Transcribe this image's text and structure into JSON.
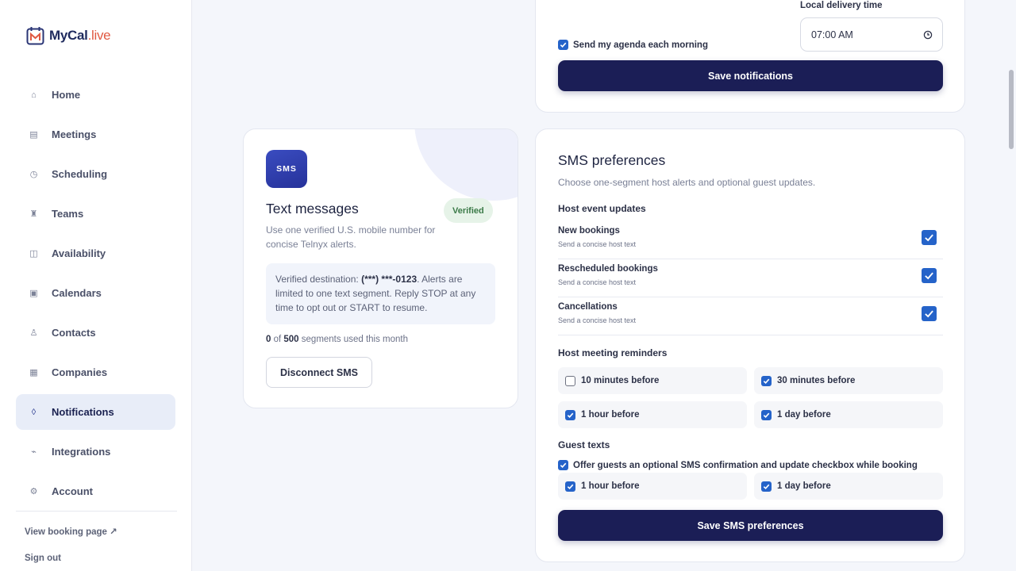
{
  "brand": {
    "name_main": "MyCal",
    "name_accent": ".live"
  },
  "sidebar": {
    "items": [
      {
        "label": "Home",
        "icon": "⌂",
        "name": "home"
      },
      {
        "label": "Meetings",
        "icon": "▤",
        "name": "meetings"
      },
      {
        "label": "Scheduling",
        "icon": "◷",
        "name": "scheduling"
      },
      {
        "label": "Teams",
        "icon": "♜",
        "name": "teams"
      },
      {
        "label": "Availability",
        "icon": "◫",
        "name": "availability"
      },
      {
        "label": "Calendars",
        "icon": "▣",
        "name": "calendars"
      },
      {
        "label": "Contacts",
        "icon": "♙",
        "name": "contacts"
      },
      {
        "label": "Companies",
        "icon": "▦",
        "name": "companies"
      },
      {
        "label": "Notifications",
        "icon": "◊",
        "name": "notifications",
        "active": true
      },
      {
        "label": "Integrations",
        "icon": "⌁",
        "name": "integrations"
      },
      {
        "label": "Account",
        "icon": "⚙",
        "name": "account"
      }
    ],
    "view_booking": "View booking page ↗",
    "sign_out": "Sign out"
  },
  "notifications_card": {
    "agenda_label": "Send my agenda each morning",
    "agenda_checked": true,
    "delivery_label": "Local delivery time",
    "delivery_time": "07:00  AM",
    "save_label": "Save notifications"
  },
  "sms_intro": {
    "badge": "SMS",
    "title": "Text messages",
    "status": "Verified",
    "description": "Use one verified U.S. mobile number for concise Telnyx alerts.",
    "dest_prefix": "Verified destination: ",
    "dest_number": "(***) ***-0123",
    "dest_suffix": ". Alerts are limited to one text segment. Reply STOP at any time to opt out or START to resume.",
    "usage_used": "0",
    "usage_of": " of ",
    "usage_total": "500",
    "usage_suffix": " segments used this month",
    "disconnect_label": "Disconnect SMS"
  },
  "sms_prefs": {
    "title": "SMS preferences",
    "subtitle": "Choose one-segment host alerts and optional guest updates.",
    "host_events_heading": "Host event updates",
    "host_events": [
      {
        "title": "New bookings",
        "sub": "Send a concise host text",
        "checked": true
      },
      {
        "title": "Rescheduled bookings",
        "sub": "Send a concise host text",
        "checked": true
      },
      {
        "title": "Cancellations",
        "sub": "Send a concise host text",
        "checked": true
      }
    ],
    "reminders_heading": "Host meeting reminders",
    "reminders": [
      {
        "label": "10 minutes before",
        "checked": false
      },
      {
        "label": "30 minutes before",
        "checked": true
      },
      {
        "label": "1 hour before",
        "checked": true
      },
      {
        "label": "1 day before",
        "checked": true
      }
    ],
    "guest_heading": "Guest texts",
    "guest_offer_label": "Offer guests an optional SMS confirmation and update checkbox while booking",
    "guest_offer_checked": true,
    "guest_reminders": [
      {
        "label": "1 hour before",
        "checked": true
      },
      {
        "label": "1 day before",
        "checked": true
      }
    ],
    "save_label": "Save SMS preferences"
  }
}
